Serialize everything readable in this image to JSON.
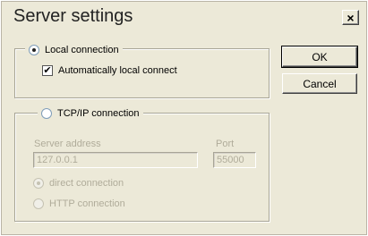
{
  "window": {
    "title": "Server settings",
    "close_glyph": "×"
  },
  "local_group": {
    "label": "Local connection",
    "selected": true,
    "auto_connect": {
      "label": "Automatically local connect",
      "checked": true,
      "mark": "✔"
    }
  },
  "tcp_group": {
    "label": "TCP/IP connection",
    "selected": false,
    "server_address": {
      "label": "Server address",
      "value": "127.0.0.1"
    },
    "port": {
      "label": "Port",
      "value": "55000"
    },
    "options": [
      {
        "label": "direct connection",
        "selected": true
      },
      {
        "label": "HTTP connection",
        "selected": false
      }
    ]
  },
  "buttons": {
    "ok": "OK",
    "cancel": "Cancel"
  }
}
